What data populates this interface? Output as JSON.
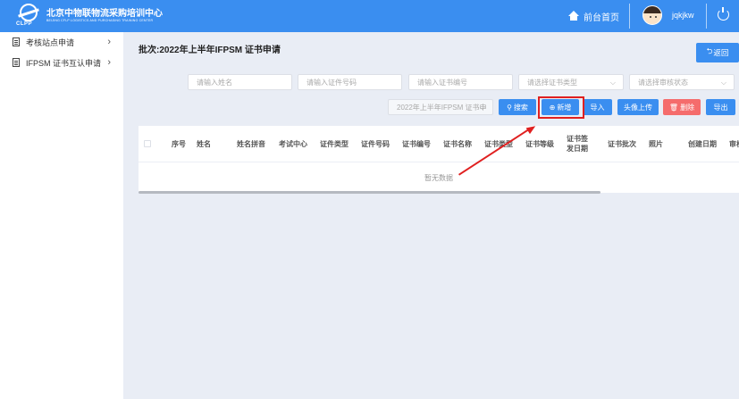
{
  "header": {
    "logo_cn": "北京中物联物流采购培训中心",
    "logo_en": "BEIJING CFLP LOGISTICS AND PURCHASING TRAINING CENTER",
    "logo_abbr": "CLPP",
    "home_label": "前台首页",
    "username": "jqkjkw",
    "brand_color": "#3a8ef0"
  },
  "sidebar": {
    "items": [
      {
        "label": "考核站点申请"
      },
      {
        "label": "IFPSM 证书互认申请"
      }
    ]
  },
  "main": {
    "title": "批次:2022年上半年IFPSM 证书申请",
    "back_label": "返回",
    "filters": {
      "name_placeholder": "请输入姓名",
      "idno_placeholder": "请输入证件号码",
      "certno_placeholder": "请输入证书编号",
      "certtype_placeholder": "请选择证书类型",
      "status_placeholder": "请选择审核状态",
      "batch_value": "2022年上半年IFPSM 证书申"
    },
    "buttons": {
      "search": "搜索",
      "add": "新增",
      "import": "导入",
      "photo_upload": "头像上传",
      "delete": "删除",
      "export": "导出"
    },
    "table": {
      "columns": [
        "序号",
        "姓名",
        "姓名拼音",
        "考试中心",
        "证件类型",
        "证件号码",
        "证书编号",
        "证书名称",
        "证书类型",
        "证书等级",
        "证书签发日期",
        "证书批次",
        "照片",
        "创建日期",
        "审核"
      ],
      "empty_text": "暂无数据"
    },
    "delete_color": "#f56c6c",
    "highlight_color": "#e02020"
  }
}
